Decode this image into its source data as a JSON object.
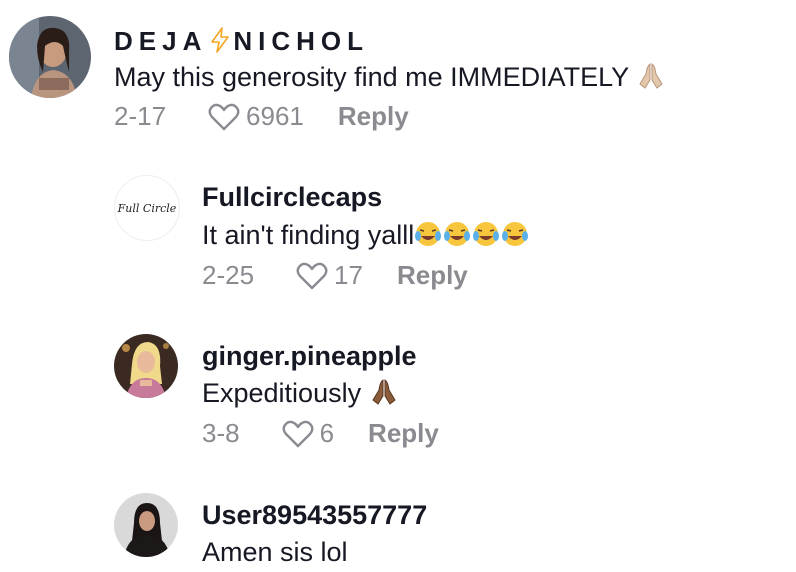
{
  "comments": [
    {
      "username_part1": "DEJA",
      "username_part2": "NICHOL",
      "text": "May this generosity find me IMMEDIATELY",
      "date": "2-17",
      "likes": "6961",
      "reply": "Reply",
      "icons": [
        "lightning-bolt-icon",
        "praying-hands-icon"
      ]
    },
    {
      "username": "Fullcirclecaps",
      "avatar_text": "Full Circle",
      "text": "It ain't finding yalll",
      "date": "2-25",
      "likes": "17",
      "reply": "Reply",
      "icons": [
        "laughing-tears-emoji"
      ]
    },
    {
      "username": "ginger.pineapple",
      "text": "Expeditiously",
      "date": "3-8",
      "likes": "6",
      "reply": "Reply",
      "icons": [
        "praying-hands-icon"
      ]
    },
    {
      "username": "User89543557777",
      "text": "Amen sis lol"
    }
  ],
  "colors": {
    "username": "#161823",
    "meta": "#8a8b91",
    "bolt": "#f5a623"
  }
}
